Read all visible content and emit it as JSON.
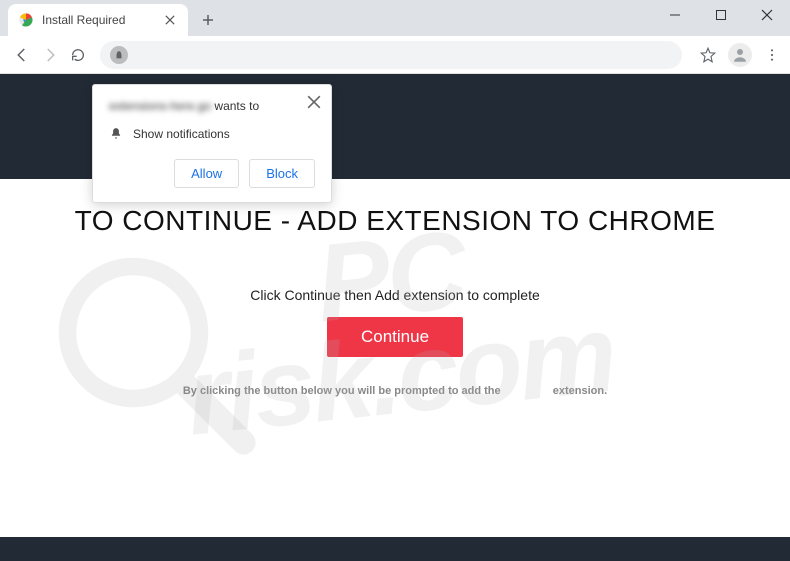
{
  "window": {
    "title": "Install Required"
  },
  "tab": {
    "title": "Install Required"
  },
  "page": {
    "headline": "TO CONTINUE - ADD EXTENSION TO CHROME",
    "subtext": "Click Continue then Add extension to complete",
    "continue_label": "Continue",
    "legal_prefix": "By clicking the button below you will be prompted to add the",
    "legal_suffix": "extension."
  },
  "permission": {
    "origin_blurred": "extensions-here.go",
    "wants_to": "wants to",
    "show_notifications": "Show notifications",
    "allow": "Allow",
    "block": "Block"
  },
  "watermark": {
    "line1": "PC",
    "line2": "risk.com"
  }
}
